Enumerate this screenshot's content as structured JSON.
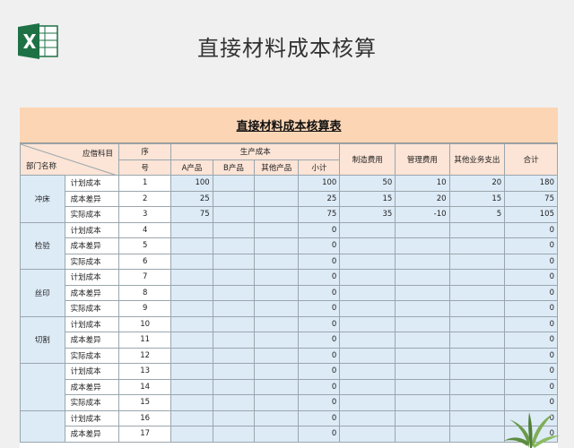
{
  "page_title": "直接材料成本核算",
  "sheet": {
    "title": "直接材料成本核算表",
    "header": {
      "corner_top": "应借科目",
      "corner_bottom": "部门名称",
      "seq_top": "序",
      "seq_bottom": "号",
      "production_cost": "生产成本",
      "product_a": "A产品",
      "product_b": "B产品",
      "other_product": "其他产品",
      "subtotal": "小计",
      "manufacturing": "制造费用",
      "management": "管理费用",
      "other_business": "其他业务支出",
      "total": "合计"
    },
    "departments": [
      {
        "name": "冲床",
        "rows": [
          {
            "label": "计划成本",
            "seq": "1",
            "a": "100",
            "b": "",
            "other": "",
            "subtotal": "100",
            "manufacturing": "50",
            "management": "10",
            "other_business": "20",
            "total": "180"
          },
          {
            "label": "成本差异",
            "seq": "2",
            "a": "25",
            "b": "",
            "other": "",
            "subtotal": "25",
            "manufacturing": "15",
            "management": "20",
            "other_business": "15",
            "total": "75"
          },
          {
            "label": "实际成本",
            "seq": "3",
            "a": "75",
            "b": "",
            "other": "",
            "subtotal": "75",
            "manufacturing": "35",
            "management": "-10",
            "other_business": "5",
            "total": "105"
          }
        ]
      },
      {
        "name": "检验",
        "rows": [
          {
            "label": "计划成本",
            "seq": "4",
            "a": "",
            "b": "",
            "other": "",
            "subtotal": "0",
            "manufacturing": "",
            "management": "",
            "other_business": "",
            "total": "0"
          },
          {
            "label": "成本差异",
            "seq": "5",
            "a": "",
            "b": "",
            "other": "",
            "subtotal": "0",
            "manufacturing": "",
            "management": "",
            "other_business": "",
            "total": "0"
          },
          {
            "label": "实际成本",
            "seq": "6",
            "a": "",
            "b": "",
            "other": "",
            "subtotal": "0",
            "manufacturing": "",
            "management": "",
            "other_business": "",
            "total": "0"
          }
        ]
      },
      {
        "name": "丝印",
        "rows": [
          {
            "label": "计划成本",
            "seq": "7",
            "a": "",
            "b": "",
            "other": "",
            "subtotal": "0",
            "manufacturing": "",
            "management": "",
            "other_business": "",
            "total": "0"
          },
          {
            "label": "成本差异",
            "seq": "8",
            "a": "",
            "b": "",
            "other": "",
            "subtotal": "0",
            "manufacturing": "",
            "management": "",
            "other_business": "",
            "total": "0"
          },
          {
            "label": "实际成本",
            "seq": "9",
            "a": "",
            "b": "",
            "other": "",
            "subtotal": "0",
            "manufacturing": "",
            "management": "",
            "other_business": "",
            "total": "0"
          }
        ]
      },
      {
        "name": "切割",
        "rows": [
          {
            "label": "计划成本",
            "seq": "10",
            "a": "",
            "b": "",
            "other": "",
            "subtotal": "0",
            "manufacturing": "",
            "management": "",
            "other_business": "",
            "total": "0"
          },
          {
            "label": "成本差异",
            "seq": "11",
            "a": "",
            "b": "",
            "other": "",
            "subtotal": "0",
            "manufacturing": "",
            "management": "",
            "other_business": "",
            "total": "0"
          },
          {
            "label": "实际成本",
            "seq": "12",
            "a": "",
            "b": "",
            "other": "",
            "subtotal": "0",
            "manufacturing": "",
            "management": "",
            "other_business": "",
            "total": "0"
          }
        ]
      },
      {
        "name": "",
        "rows": [
          {
            "label": "计划成本",
            "seq": "13",
            "a": "",
            "b": "",
            "other": "",
            "subtotal": "0",
            "manufacturing": "",
            "management": "",
            "other_business": "",
            "total": "0"
          },
          {
            "label": "成本差异",
            "seq": "14",
            "a": "",
            "b": "",
            "other": "",
            "subtotal": "0",
            "manufacturing": "",
            "management": "",
            "other_business": "",
            "total": "0"
          },
          {
            "label": "实际成本",
            "seq": "15",
            "a": "",
            "b": "",
            "other": "",
            "subtotal": "0",
            "manufacturing": "",
            "management": "",
            "other_business": "",
            "total": "0"
          }
        ]
      },
      {
        "name": "",
        "rows": [
          {
            "label": "计划成本",
            "seq": "16",
            "a": "",
            "b": "",
            "other": "",
            "subtotal": "0",
            "manufacturing": "",
            "management": "",
            "other_business": "",
            "total": "0"
          },
          {
            "label": "成本差异",
            "seq": "17",
            "a": "",
            "b": "",
            "other": "",
            "subtotal": "0",
            "manufacturing": "",
            "management": "",
            "other_business": "",
            "total": "0"
          }
        ]
      }
    ]
  },
  "icons": {
    "logo": "excel-logo-icon",
    "plant": "plant-decoration-icon"
  },
  "colors": {
    "title_bar": "#fcd5b4",
    "header_fill": "#fce4d6",
    "data_fill": "#ddebf7",
    "excel_green": "#1e7145"
  }
}
